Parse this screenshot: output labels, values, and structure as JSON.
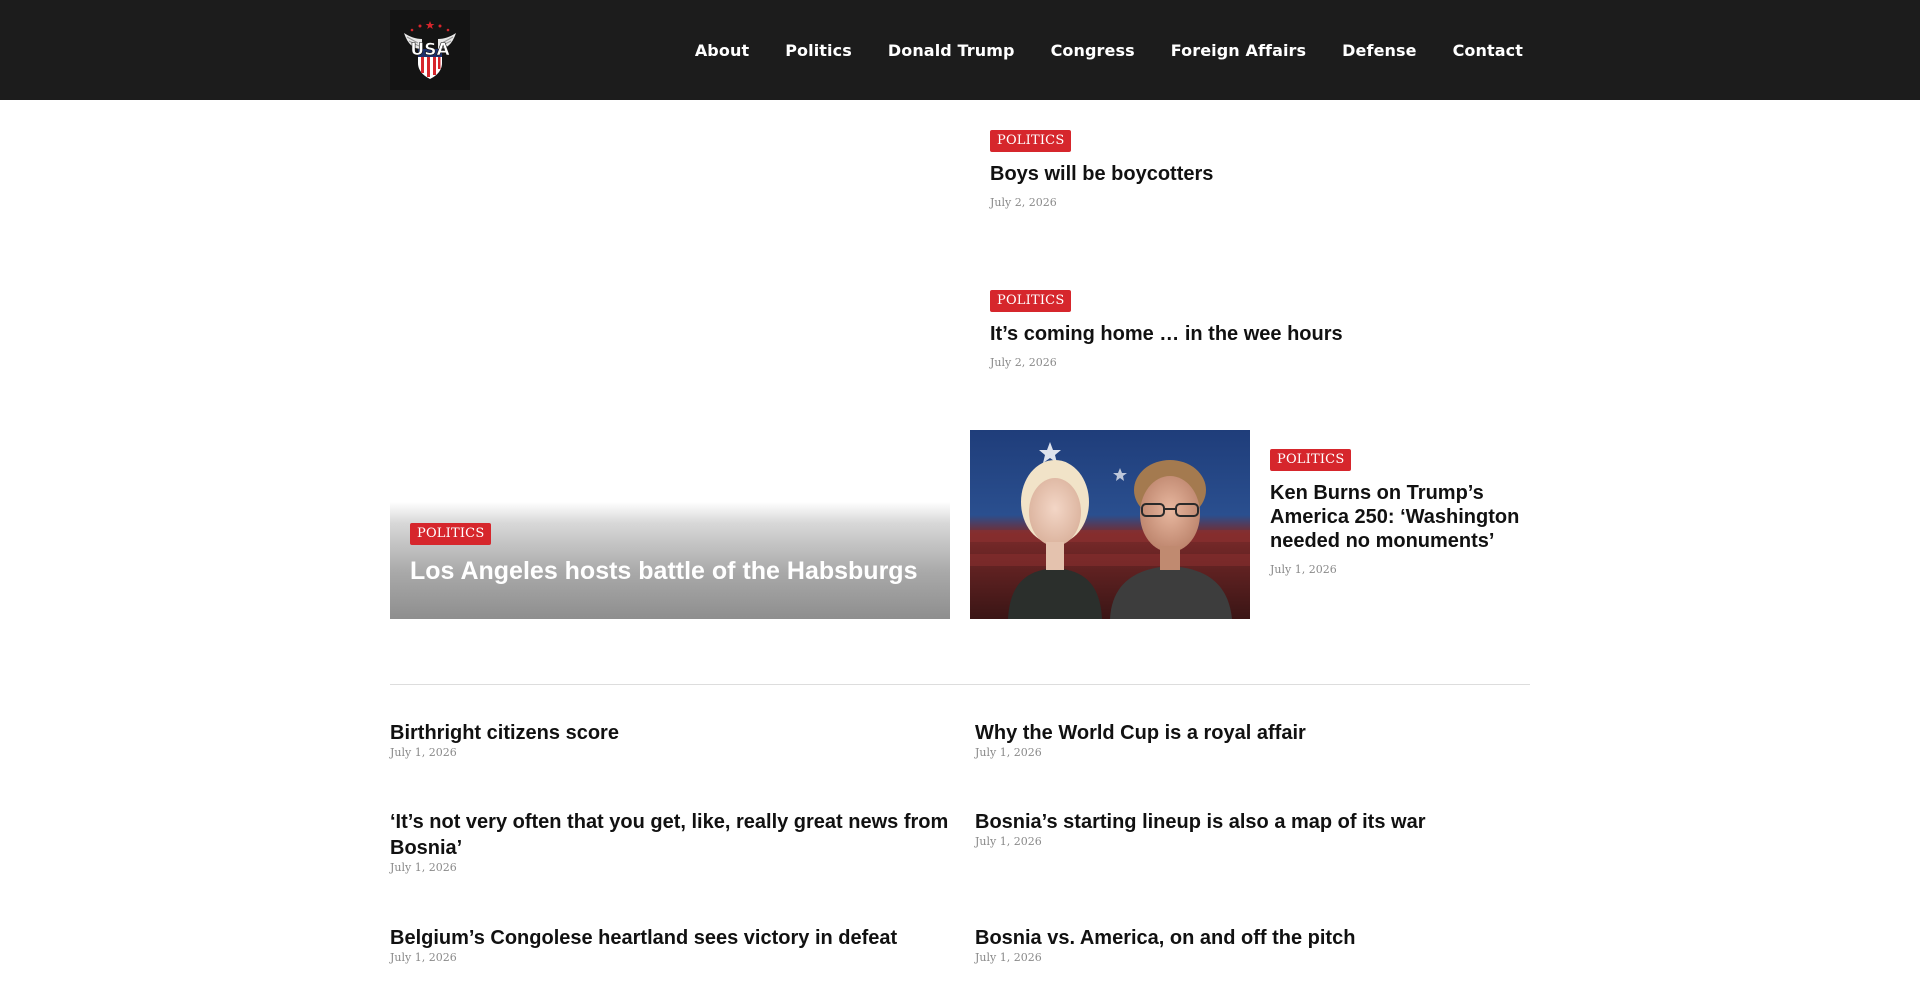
{
  "header": {
    "logo_text": "USA",
    "nav": [
      "About",
      "Politics",
      "Donald Trump",
      "Congress",
      "Foreign Affairs",
      "Defense",
      "Contact"
    ]
  },
  "top_stories": [
    {
      "category": "POLITICS",
      "title": "Boys will be boycotters",
      "date": "July 2, 2026"
    },
    {
      "category": "POLITICS",
      "title": "It’s coming home … in the wee hours",
      "date": "July 2, 2026"
    }
  ],
  "hero": {
    "category": "POLITICS",
    "title": "Los Angeles hosts battle of the Habsburgs"
  },
  "feature": {
    "category": "POLITICS",
    "title": "Ken Burns on Trump’s America 250: ‘Washington needed no monuments’",
    "date": "July 1, 2026"
  },
  "list": [
    {
      "title": "Birthright citizens score",
      "date": "July 1, 2026"
    },
    {
      "title": "Why the World Cup is a royal affair",
      "date": "July 1, 2026"
    },
    {
      "title": "‘It’s not very often that you get, like, really great news from Bosnia’",
      "date": "July 1, 2026"
    },
    {
      "title": "Bosnia’s starting lineup is also a map of its war",
      "date": "July 1, 2026"
    },
    {
      "title": "Belgium’s Congolese heartland sees victory in defeat",
      "date": "July 1, 2026"
    },
    {
      "title": "Bosnia vs. America, on and off the pitch",
      "date": "July 1, 2026"
    }
  ],
  "colors": {
    "header_bg": "#1c1c1c",
    "accent": "#d6262c"
  }
}
